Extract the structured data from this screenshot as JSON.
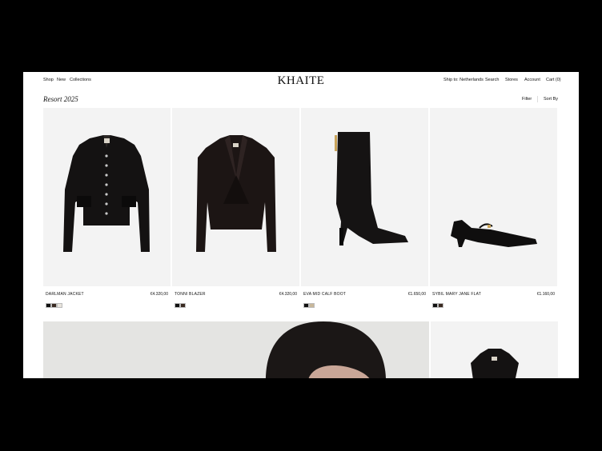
{
  "nav": {
    "left": [
      "Shop",
      "New",
      "Collections"
    ],
    "logo": "KHAITE",
    "right": [
      "Ship to: Netherlands",
      "Search",
      "Stores",
      "Account",
      "Cart (0)"
    ]
  },
  "collection": {
    "title": "Resort 2025",
    "filter": "Filter",
    "sort": "Sort By"
  },
  "products": [
    {
      "name": "DARLMAN JACKET",
      "price": "€4.320,00",
      "swatches": [
        "#111111",
        "#3a2b22",
        "#e8e4dc"
      ]
    },
    {
      "name": "TONNI BLAZER",
      "price": "€4.320,00",
      "swatches": [
        "#111111",
        "#3a2b22"
      ]
    },
    {
      "name": "EVA MID CALF BOOT",
      "price": "€1.650,00",
      "swatches": [
        "#111111",
        "#c8b79a"
      ]
    },
    {
      "name": "SYBIL MARY JANE FLAT",
      "price": "€1.160,00",
      "swatches": [
        "#111111",
        "#3a2b22"
      ]
    }
  ]
}
